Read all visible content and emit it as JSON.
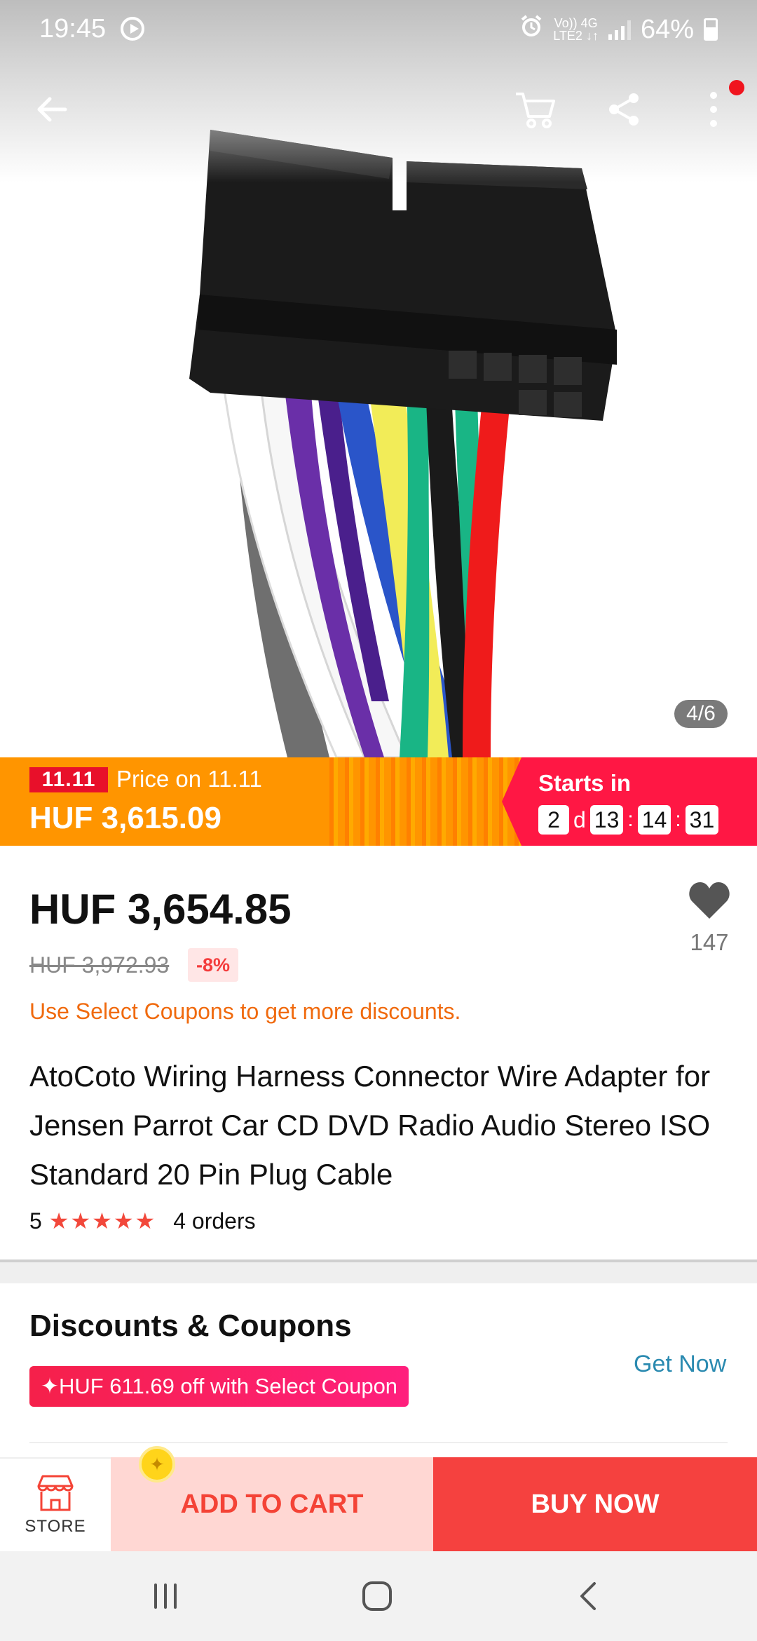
{
  "status_bar": {
    "time": "19:45",
    "network_line1": "Vo)) 4G",
    "network_line2": "LTE2 ↓↑",
    "battery": "64%"
  },
  "image": {
    "counter": "4/6",
    "icons": [
      "back-arrow-icon",
      "cart-icon",
      "share-icon",
      "more-vertical-icon"
    ],
    "wire_colors": [
      "#6f6f6f",
      "#ffffff",
      "#6a2fa8",
      "#2a55c9",
      "#f2ec58",
      "#19b585",
      "#1a1a1a",
      "#ef1b1b"
    ]
  },
  "flash_banner": {
    "tag": "11.11",
    "label": "Price on 11.11",
    "price": "HUF 3,615.09",
    "starts_label": "Starts in",
    "days": "2",
    "days_unit": "d",
    "hours": "13",
    "minutes": "14",
    "seconds": "31",
    "colors": {
      "orange": "#ff9500",
      "pink": "#ff1744"
    }
  },
  "product": {
    "price": "HUF 3,654.85",
    "original_price": "HUF 3,972.93",
    "discount": "-8%",
    "coupon_hint": "Use Select Coupons to get more discounts.",
    "title": "AtoCoto Wiring Harness Connector Wire Adapter for Jensen Parrot Car CD DVD Radio Audio Stereo ISO Standard 20 Pin Plug Cable",
    "rating": "5",
    "stars": "★★★★★",
    "orders": "4 orders",
    "wishlist_count": "147"
  },
  "coupons": {
    "heading": "Discounts & Coupons",
    "coupon_label": "✦HUF 611.69 off with Select Coupon",
    "get_now": "Get Now"
  },
  "action_bar": {
    "store": "STORE",
    "add_to_cart": "ADD TO CART",
    "buy_now": "BUY NOW"
  },
  "system_nav": [
    "recent-apps-icon",
    "home-icon",
    "back-icon"
  ]
}
